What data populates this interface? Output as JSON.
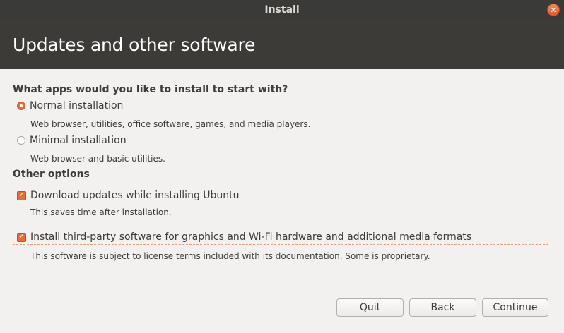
{
  "window": {
    "title": "Install",
    "close_symbol": "✕"
  },
  "header": {
    "title": "Updates and other software"
  },
  "apps_section": {
    "title": "What apps would you like to install to start with?",
    "options": [
      {
        "label": "Normal installation",
        "description": "Web browser, utilities, office software, games, and media players.",
        "selected": true
      },
      {
        "label": "Minimal installation",
        "description": "Web browser and basic utilities.",
        "selected": false
      }
    ]
  },
  "other_section": {
    "title": "Other options",
    "options": [
      {
        "label": "Download updates while installing Ubuntu",
        "description": "This saves time after installation.",
        "checked": true
      },
      {
        "label": "Install third-party software for graphics and Wi-Fi hardware and additional media formats",
        "description": "This software is subject to license terms included with its documentation. Some is proprietary.",
        "checked": true
      }
    ]
  },
  "buttons": {
    "quit": "Quit",
    "back": "Back",
    "continue": "Continue"
  },
  "colors": {
    "accent": "#e66e3b",
    "titlebar": "#3a3a38",
    "header": "#3c3b37",
    "background": "#f2f1f0"
  },
  "icons": {
    "close": "close-icon",
    "checkbox_checked": "checkmark-icon",
    "radio_selected": "radio-dot-icon"
  }
}
